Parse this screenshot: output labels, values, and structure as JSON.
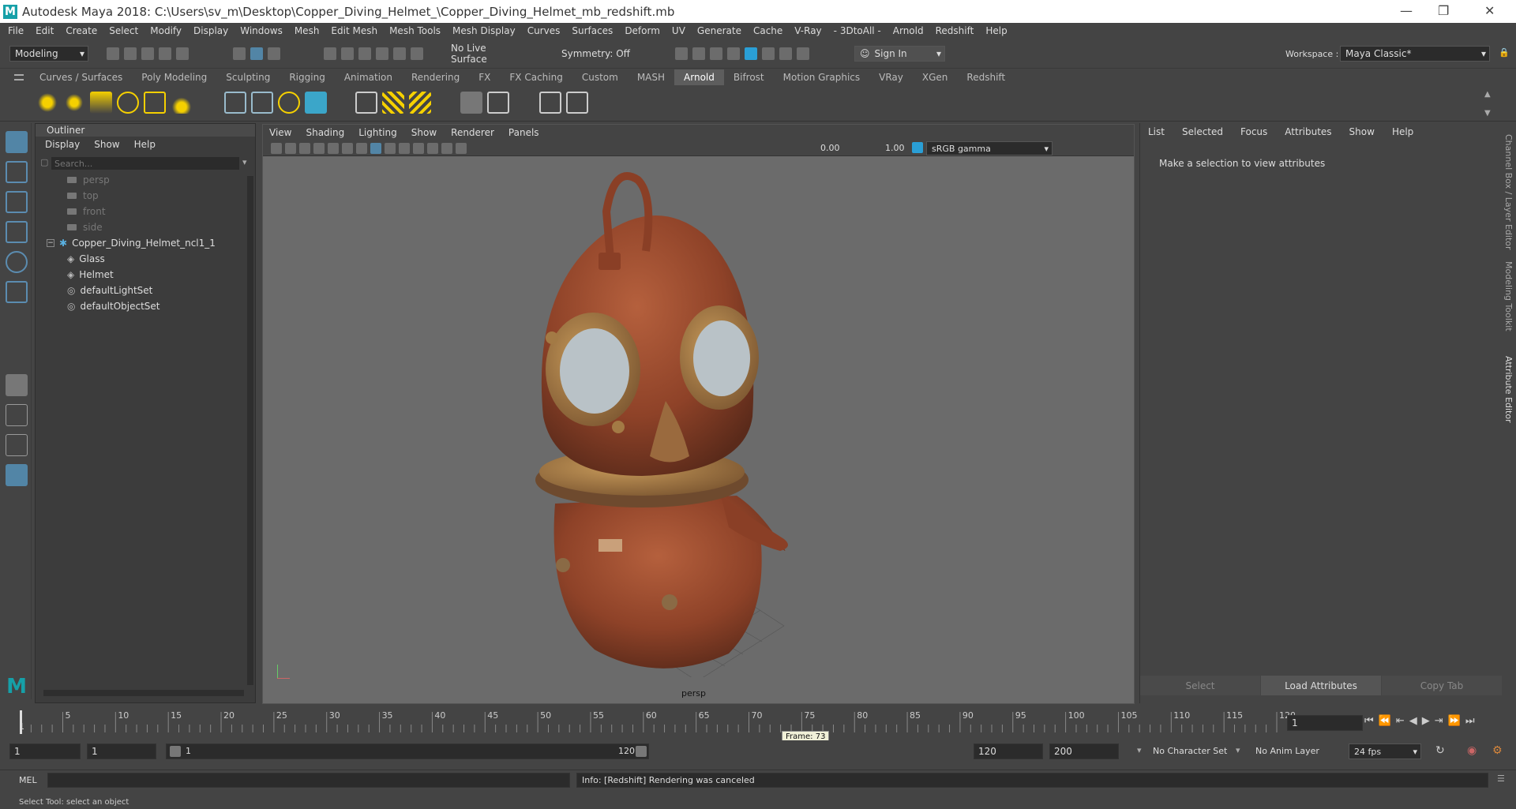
{
  "window": {
    "title": "Autodesk Maya 2018: C:\\Users\\sv_m\\Desktop\\Copper_Diving_Helmet_\\Copper_Diving_Helmet_mb_redshift.mb",
    "logo": "M"
  },
  "menubar": [
    "File",
    "Edit",
    "Create",
    "Select",
    "Modify",
    "Display",
    "Windows",
    "Mesh",
    "Edit Mesh",
    "Mesh Tools",
    "Mesh Display",
    "Curves",
    "Surfaces",
    "Deform",
    "UV",
    "Generate",
    "Cache",
    "V-Ray",
    "- 3DtoAll -",
    "Arnold",
    "Redshift",
    "Help"
  ],
  "status": {
    "menuset": "Modeling",
    "live_surface": "No Live Surface",
    "symmetry": "Symmetry: Off",
    "sign_in": "Sign In",
    "workspace_label": "Workspace :",
    "workspace": "Maya Classic*"
  },
  "shelf_tabs": [
    "Curves / Surfaces",
    "Poly Modeling",
    "Sculpting",
    "Rigging",
    "Animation",
    "Rendering",
    "FX",
    "FX Caching",
    "Custom",
    "MASH",
    "Arnold",
    "Bifrost",
    "Motion Graphics",
    "VRay",
    "XGen",
    "Redshift"
  ],
  "shelf_active": "Arnold",
  "outliner": {
    "title": "Outliner",
    "menu": [
      "Display",
      "Show",
      "Help"
    ],
    "search_placeholder": "Search...",
    "items": [
      {
        "label": "persp",
        "type": "camera"
      },
      {
        "label": "top",
        "type": "camera"
      },
      {
        "label": "front",
        "type": "camera"
      },
      {
        "label": "side",
        "type": "camera"
      },
      {
        "label": "Copper_Diving_Helmet_ncl1_1",
        "type": "group"
      },
      {
        "label": "Glass",
        "type": "mesh"
      },
      {
        "label": "Helmet",
        "type": "mesh"
      },
      {
        "label": "defaultLightSet",
        "type": "set"
      },
      {
        "label": "defaultObjectSet",
        "type": "set"
      }
    ]
  },
  "viewport": {
    "menu": [
      "View",
      "Shading",
      "Lighting",
      "Show",
      "Renderer",
      "Panels"
    ],
    "exposure": "0.00",
    "gamma": "1.00",
    "color_space": "sRGB gamma",
    "camera_label": "persp"
  },
  "attribute_editor": {
    "menu": [
      "List",
      "Selected",
      "Focus",
      "Attributes",
      "Show",
      "Help"
    ],
    "message": "Make a selection to view attributes",
    "buttons": [
      "Select",
      "Load Attributes",
      "Copy Tab"
    ]
  },
  "side_tabs": [
    "Channel Box / Layer Editor",
    "Modeling Toolkit",
    "Attribute Editor"
  ],
  "timeline": {
    "ticks": [
      "5",
      "10",
      "15",
      "20",
      "25",
      "30",
      "35",
      "40",
      "45",
      "50",
      "55",
      "60",
      "65",
      "70",
      "75",
      "80",
      "85",
      "90",
      "95",
      "100",
      "105",
      "110",
      "115",
      "120"
    ],
    "start_label": "1",
    "current_frame": "1",
    "frame_tooltip": "Frame: 73"
  },
  "range": {
    "start": "1",
    "playback_start": "1",
    "slider_start": "1",
    "slider_end": "120",
    "playback_end": "120",
    "end": "200",
    "character_set": "No Character Set",
    "anim_layer": "No Anim Layer",
    "fps": "24 fps"
  },
  "command": {
    "mode": "MEL",
    "result": "Info:  [Redshift] Rendering was canceled"
  },
  "helpline": "Select Tool: select an object",
  "colors": {
    "bg": "#444444",
    "viewport": "#6b6b6b",
    "accent": "#5285a6",
    "maya_teal": "#16a0a8"
  }
}
